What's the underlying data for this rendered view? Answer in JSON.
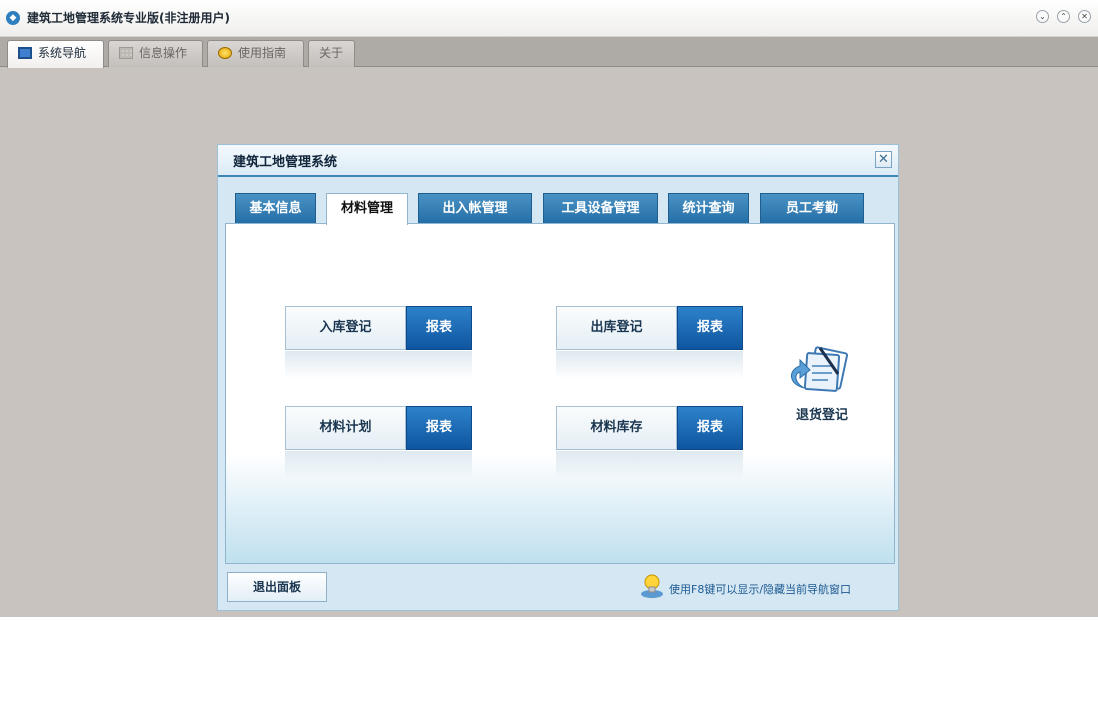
{
  "window": {
    "title": "建筑工地管理系统专业版(非注册用户)",
    "controls": [
      "minimize",
      "maximize",
      "close"
    ]
  },
  "main_tabs": [
    {
      "label": "系统导航",
      "icon": "monitor-icon",
      "active": true
    },
    {
      "label": "信息操作",
      "icon": "grid-icon",
      "active": false
    },
    {
      "label": "使用指南",
      "icon": "guide-icon",
      "active": false
    },
    {
      "label": "关于",
      "icon": "",
      "active": false
    }
  ],
  "panel": {
    "title": "建筑工地管理系统",
    "close_symbol": "✕",
    "tabs": [
      {
        "label": "基本信息",
        "active": false
      },
      {
        "label": "材料管理",
        "active": true
      },
      {
        "label": "出入帐管理",
        "active": false
      },
      {
        "label": "工具设备管理",
        "active": false
      },
      {
        "label": "统计查询",
        "active": false
      },
      {
        "label": "员工考勤",
        "active": false
      }
    ],
    "buttons": [
      {
        "label": "入库登记",
        "report": "报表"
      },
      {
        "label": "出库登记",
        "report": "报表"
      },
      {
        "label": "材料计划",
        "report": "报表"
      },
      {
        "label": "材料库存",
        "report": "报表"
      }
    ],
    "return_label": "退货登记",
    "exit_label": "退出面板",
    "hint": "使用F8键可以显示/隐藏当前导航窗口"
  },
  "colors": {
    "accent": "#1d6fb0",
    "report_button": "#1559a3",
    "workspace": "#c8c3bf"
  }
}
